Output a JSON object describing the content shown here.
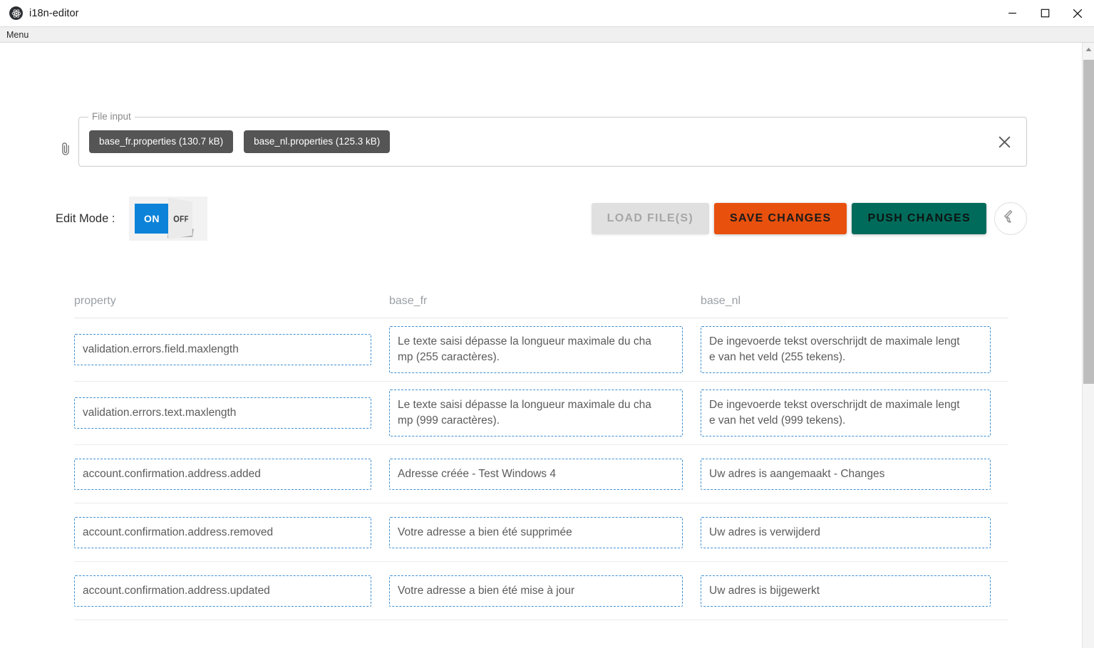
{
  "window": {
    "title": "i18n-editor",
    "app_icon": "atom-icon",
    "controls": {
      "minimize": "minimize-icon",
      "maximize": "maximize-icon",
      "close": "close-icon"
    }
  },
  "menubar": {
    "items": [
      {
        "label": "Menu"
      }
    ]
  },
  "file_input": {
    "attach_icon": "paperclip-icon",
    "legend": "File input",
    "clear_icon": "close-icon",
    "files": [
      {
        "label": "base_fr.properties (130.7 kB)"
      },
      {
        "label": "base_nl.properties (125.3 kB)"
      }
    ]
  },
  "controls": {
    "edit_mode_label": "Edit Mode :",
    "toggle": {
      "on_label": "ON",
      "off_label": "OFF",
      "state": "ON"
    },
    "buttons": {
      "load": "LOAD FILE(S)",
      "save": "SAVE CHANGES",
      "push": "PUSH CHANGES",
      "settings_icon": "wrench-icon"
    },
    "colors": {
      "toggle_on": "#0c83d9",
      "save": "#e8500d",
      "push": "#006b5b",
      "disabled": "#e0e0e0",
      "field_border": "#3f8fd4"
    }
  },
  "table": {
    "headers": {
      "property": "property",
      "base_fr": "base_fr",
      "base_nl": "base_nl"
    },
    "rows": [
      {
        "property": "validation.errors.field.maxlength",
        "base_fr": "Le texte saisi dépasse la longueur maximale du cha\nmp (255 caractères).",
        "base_nl": "De ingevoerde tekst overschrijdt de maximale lengt\ne van het veld (255 tekens)."
      },
      {
        "property": "validation.errors.text.maxlength",
        "base_fr": "Le texte saisi dépasse la longueur maximale du cha\nmp (999 caractères).",
        "base_nl": "De ingevoerde tekst overschrijdt de maximale lengt\ne van het veld (999 tekens)."
      },
      {
        "property": "account.confirmation.address.added",
        "base_fr": "Adresse créée - Test Windows 4",
        "base_nl": "Uw adres is aangemaakt - Changes"
      },
      {
        "property": "account.confirmation.address.removed",
        "base_fr": "Votre adresse a bien été supprimée",
        "base_nl": "Uw adres is verwijderd"
      },
      {
        "property": "account.confirmation.address.updated",
        "base_fr": "Votre adresse a bien été mise à jour",
        "base_nl": "Uw adres is bijgewerkt"
      }
    ]
  },
  "scrollbar": {
    "up_arrow": "chevron-up-icon"
  }
}
